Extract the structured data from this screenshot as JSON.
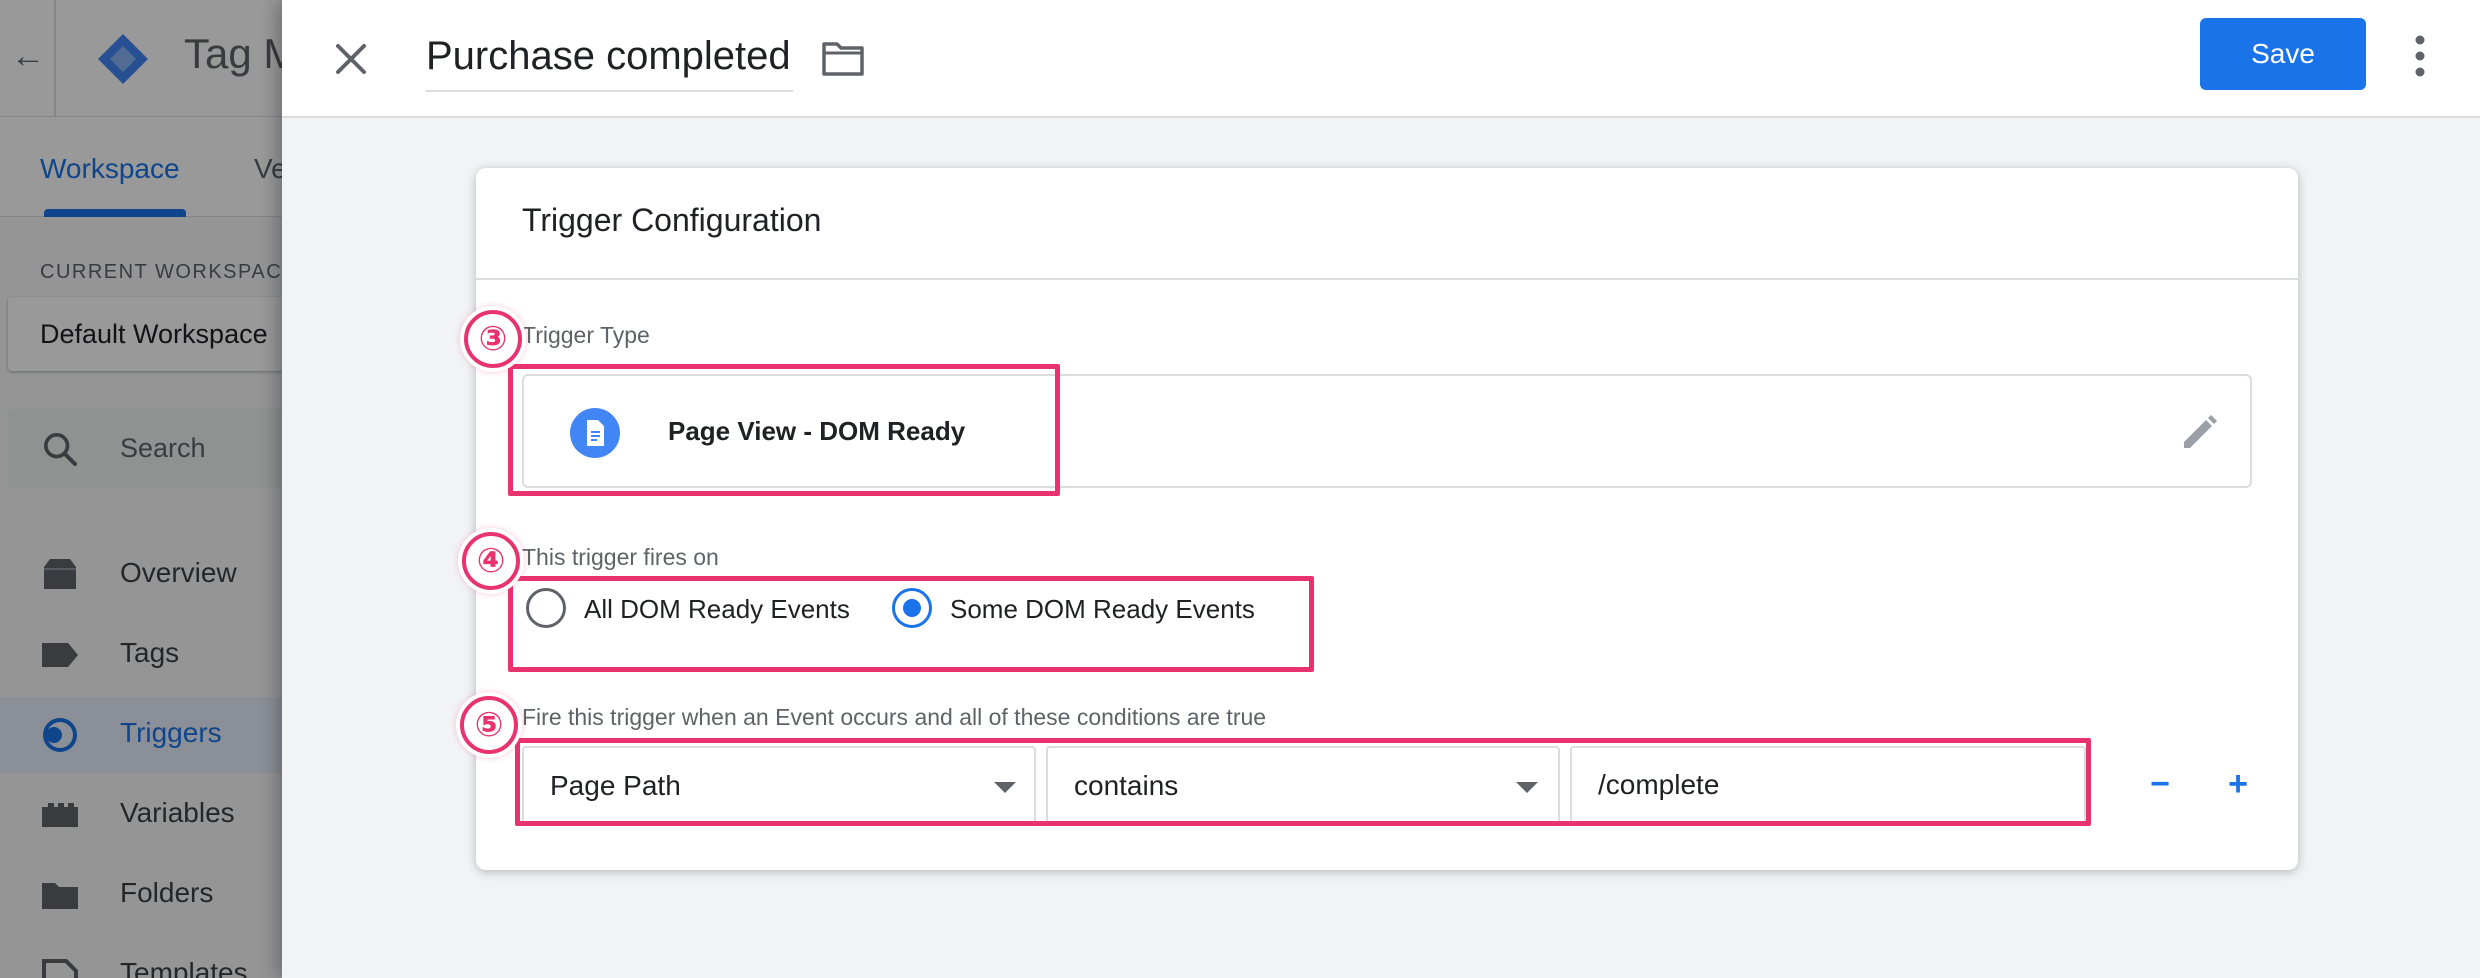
{
  "background_app": {
    "app_name": "Tag M",
    "tabs": [
      {
        "label": "Workspace",
        "active": true
      },
      {
        "label": "Ve",
        "active": false
      }
    ],
    "workspace_label": "CURRENT WORKSPACE",
    "workspace_name": "Default Workspace",
    "search_placeholder": "Search",
    "nav_items": [
      {
        "label": "Overview",
        "icon": "inbox-icon",
        "active": false
      },
      {
        "label": "Tags",
        "icon": "label-icon",
        "active": false
      },
      {
        "label": "Triggers",
        "icon": "trigger-icon",
        "active": true
      },
      {
        "label": "Variables",
        "icon": "variables-icon",
        "active": false
      },
      {
        "label": "Folders",
        "icon": "folder-icon",
        "active": false
      },
      {
        "label": "Templates",
        "icon": "template-icon",
        "active": false
      }
    ]
  },
  "editor": {
    "title": "Purchase completed",
    "save_label": "Save"
  },
  "card": {
    "title": "Trigger Configuration",
    "trigger_type_label": "Trigger Type",
    "trigger_type_name": "Page View - DOM Ready",
    "fires_on_label": "This trigger fires on",
    "fires_on_options": [
      {
        "label": "All DOM Ready Events",
        "selected": false
      },
      {
        "label": "Some DOM Ready Events",
        "selected": true
      }
    ],
    "condition_label": "Fire this trigger when an Event occurs and all of these conditions are true",
    "condition": {
      "variable": "Page Path",
      "operator": "contains",
      "value": "/complete"
    },
    "remove_label": "−",
    "add_label": "+"
  },
  "annotations": [
    "③",
    "④",
    "⑤"
  ],
  "colors": {
    "accent": "#1a73e8",
    "highlight": "#e8336e"
  }
}
